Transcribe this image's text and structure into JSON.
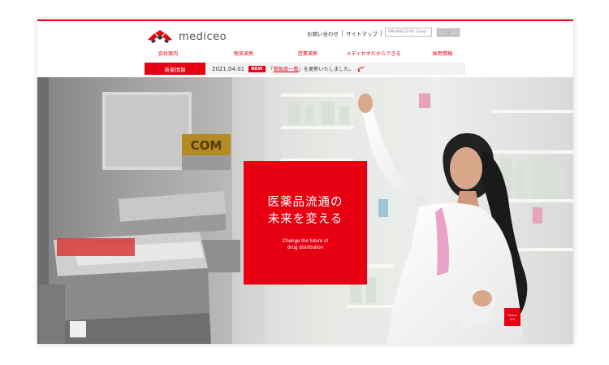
{
  "header": {
    "logo_text": "mediceo",
    "util_links": [
      "お問い合わせ",
      "サイトマップ"
    ],
    "search": {
      "placeholder": "ENHANCED BY Googl"
    }
  },
  "gnav": {
    "items": [
      "会社案内",
      "物流革新",
      "営業革新",
      "メディセオだからできる",
      "採用情報"
    ]
  },
  "news": {
    "label": "新着情報",
    "date": "2021.04.01",
    "badge": "NEW",
    "prefix": "「",
    "link_text": "取扱品一覧",
    "suffix": "」を更新いたしました。"
  },
  "hero": {
    "machine_label": "COM",
    "tagline_jp_line1": "医薬品流通の",
    "tagline_jp_line2": "未来を変える",
    "tagline_en_line1": "Change the future of",
    "tagline_en_line2": "drug distribution",
    "corner_badge_line1": "Peace",
    "corner_badge_line2": "ICO"
  },
  "colors": {
    "brand_red": "#e60012",
    "news_bg": "#f3f3f3"
  }
}
